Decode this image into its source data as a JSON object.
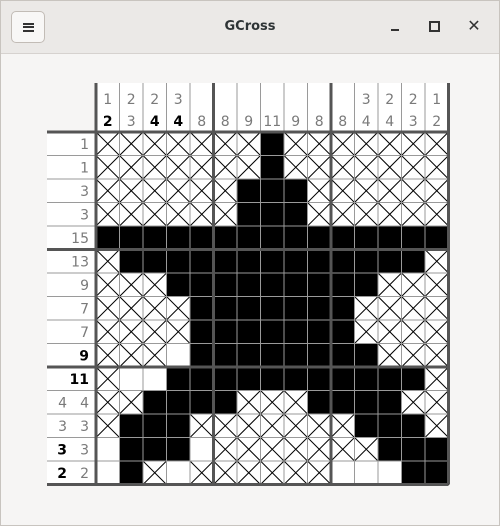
{
  "window": {
    "title": "GCross",
    "menu_icon": "hamburger-menu-icon",
    "controls": [
      "minimize-icon",
      "maximize-icon",
      "close-icon"
    ]
  },
  "puzzle": {
    "size": 15,
    "column_clues": [
      [
        {
          "v": "1"
        },
        {
          "v": "2",
          "b": true
        }
      ],
      [
        {
          "v": "2"
        },
        {
          "v": "3"
        }
      ],
      [
        {
          "v": "2"
        },
        {
          "v": "4",
          "b": true
        }
      ],
      [
        {
          "v": "3"
        },
        {
          "v": "4",
          "b": true
        }
      ],
      [
        {
          "v": "8"
        }
      ],
      [
        {
          "v": "8"
        }
      ],
      [
        {
          "v": "9"
        }
      ],
      [
        {
          "v": "11"
        }
      ],
      [
        {
          "v": "9"
        }
      ],
      [
        {
          "v": "8"
        }
      ],
      [
        {
          "v": "8"
        }
      ],
      [
        {
          "v": "3"
        },
        {
          "v": "4"
        }
      ],
      [
        {
          "v": "2"
        },
        {
          "v": "4"
        }
      ],
      [
        {
          "v": "2"
        },
        {
          "v": "3"
        }
      ],
      [
        {
          "v": "1"
        },
        {
          "v": "2"
        }
      ]
    ],
    "row_clues": [
      [
        {
          "v": "1"
        }
      ],
      [
        {
          "v": "1"
        }
      ],
      [
        {
          "v": "3"
        }
      ],
      [
        {
          "v": "3"
        }
      ],
      [
        {
          "v": "15"
        }
      ],
      [
        {
          "v": "13"
        }
      ],
      [
        {
          "v": "9"
        }
      ],
      [
        {
          "v": "7"
        }
      ],
      [
        {
          "v": "7"
        }
      ],
      [
        {
          "v": "9",
          "b": true
        }
      ],
      [
        {
          "v": "11",
          "b": true
        }
      ],
      [
        {
          "v": "4"
        },
        {
          "v": "4"
        }
      ],
      [
        {
          "v": "3"
        },
        {
          "v": "3"
        }
      ],
      [
        {
          "v": "3",
          "b": true
        },
        {
          "v": "3"
        }
      ],
      [
        {
          "v": "2",
          "b": true
        },
        {
          "v": "2"
        }
      ]
    ],
    "grid": [
      "xxxxxxx#xxxxxxx",
      "xxxxxxx#xxxxxxx",
      "xxxxxx###xxxxxx",
      "xxxxxx###xxxxxx",
      "###############",
      "x#############x",
      "xxx#########xxx",
      "xxxx#######xxxx",
      "xxxx#######xxxx",
      "xxx.########xxx",
      "x..###########x",
      "xx####xxx####xx",
      "x###xxxxxxx###x",
      ".###.xxxxxxx###",
      ".#x.xxxxxx...##"
    ],
    "legend": {
      "#": "filled",
      "x": "crossed",
      ".": "empty"
    }
  }
}
